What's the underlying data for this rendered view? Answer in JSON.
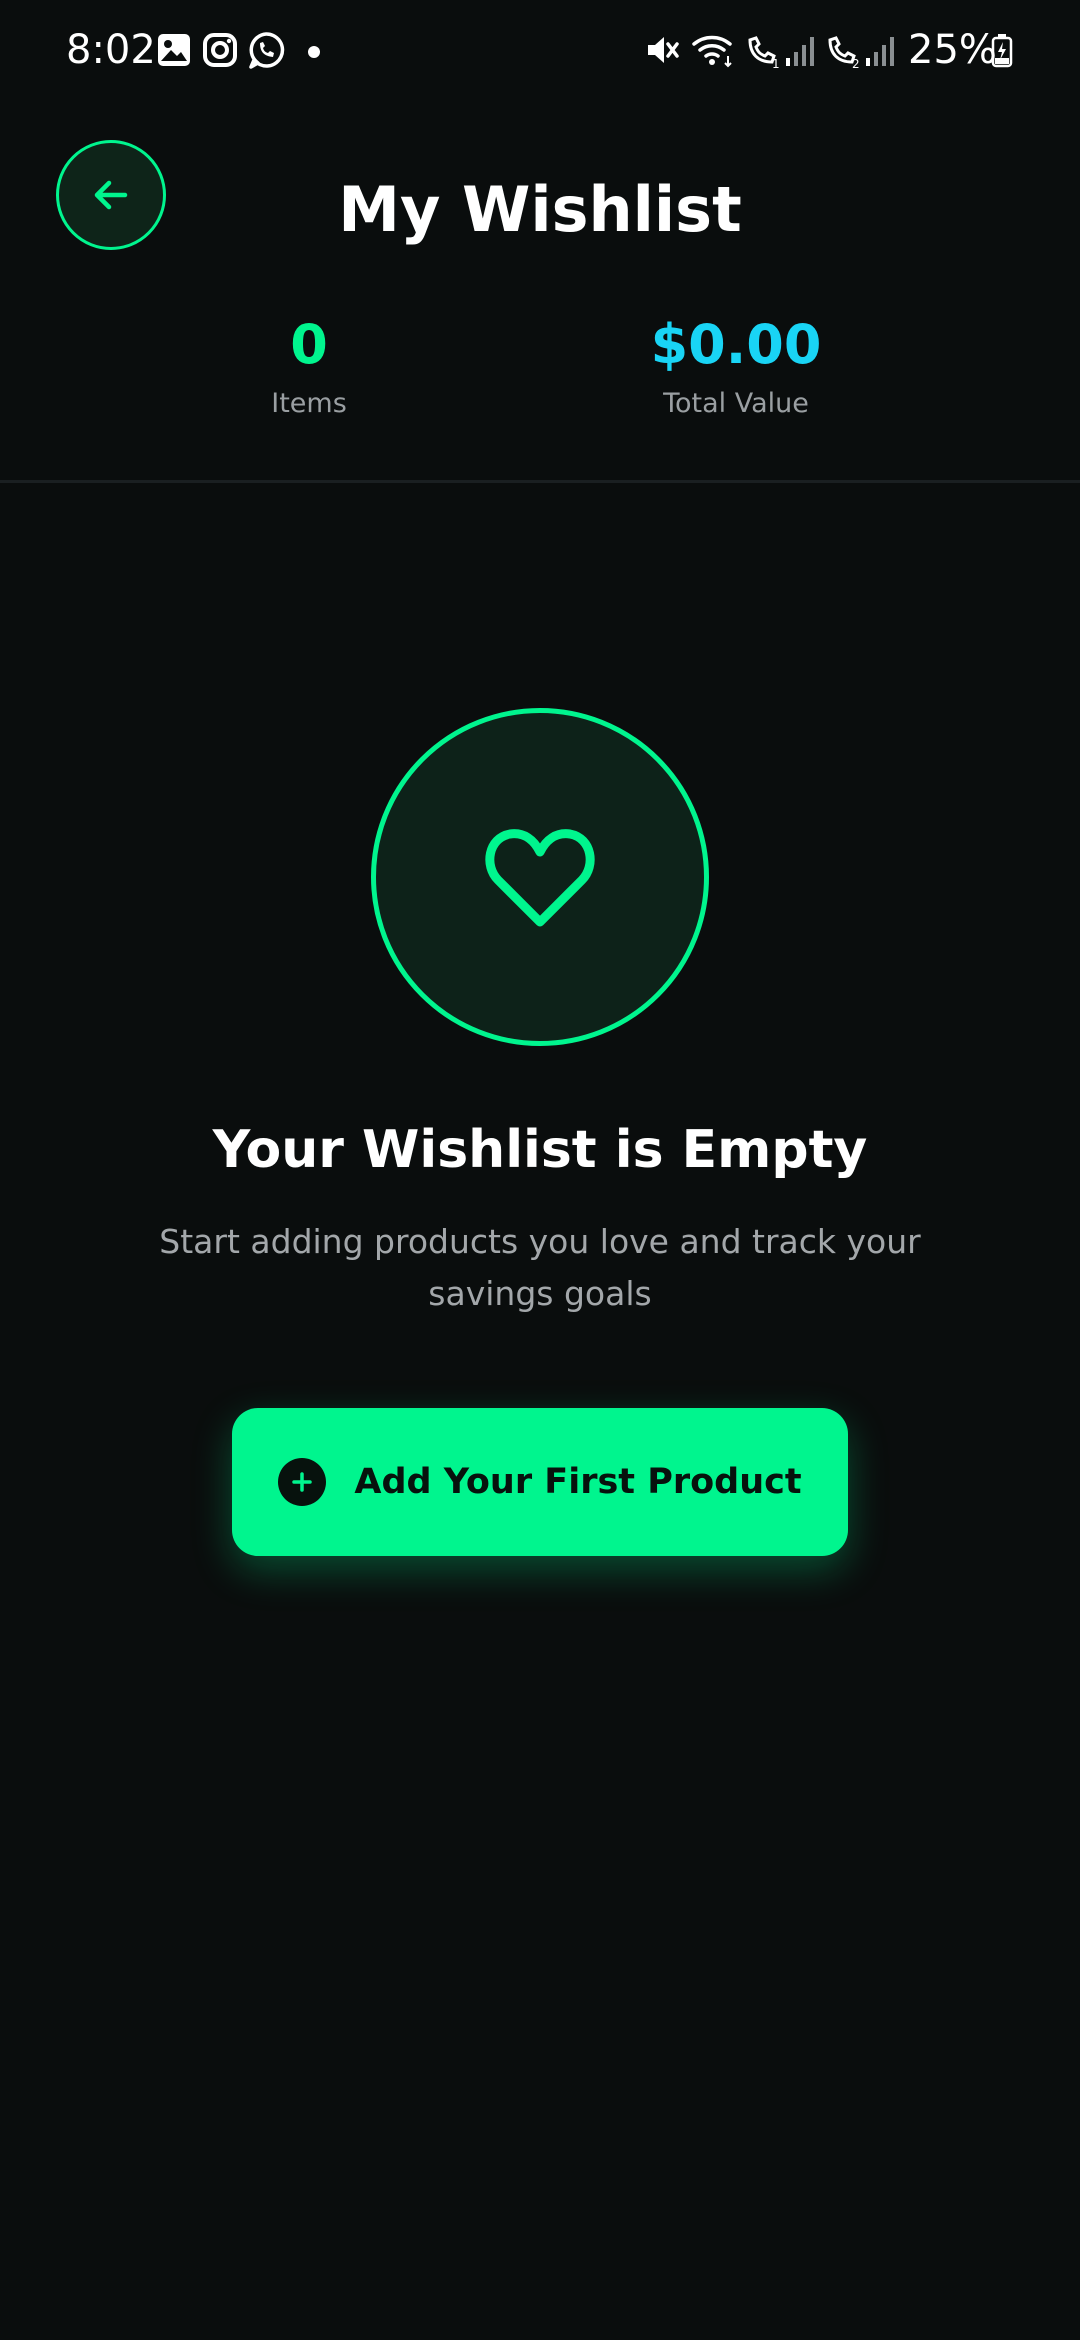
{
  "status_bar": {
    "time": "8:02",
    "battery": "25%",
    "left_icons": [
      "gallery-icon",
      "instagram-icon",
      "whatsapp-icon"
    ],
    "right_icons": [
      "mute-icon",
      "wifi-icon",
      "volte-sim1-icon",
      "signal-sim1-icon",
      "volte-sim2-icon",
      "signal-sim2-icon",
      "battery-icon"
    ]
  },
  "header": {
    "title": "My Wishlist",
    "back_icon": "arrow-left-icon"
  },
  "stats": {
    "items_count": "0",
    "items_label": "Items",
    "total_value": "$0.00",
    "total_value_label": "Total Value"
  },
  "empty_state": {
    "icon": "heart-icon",
    "title": "Your Wishlist is Empty",
    "subtitle": "Start adding products you love and track your savings goals"
  },
  "cta": {
    "label": "Add Your First Product",
    "icon": "plus-circle-icon"
  },
  "colors": {
    "background": "#0a0d0d",
    "accent_green": "#00f58e",
    "accent_cyan": "#19d4f5",
    "muted_text": "#9a9fa2"
  }
}
